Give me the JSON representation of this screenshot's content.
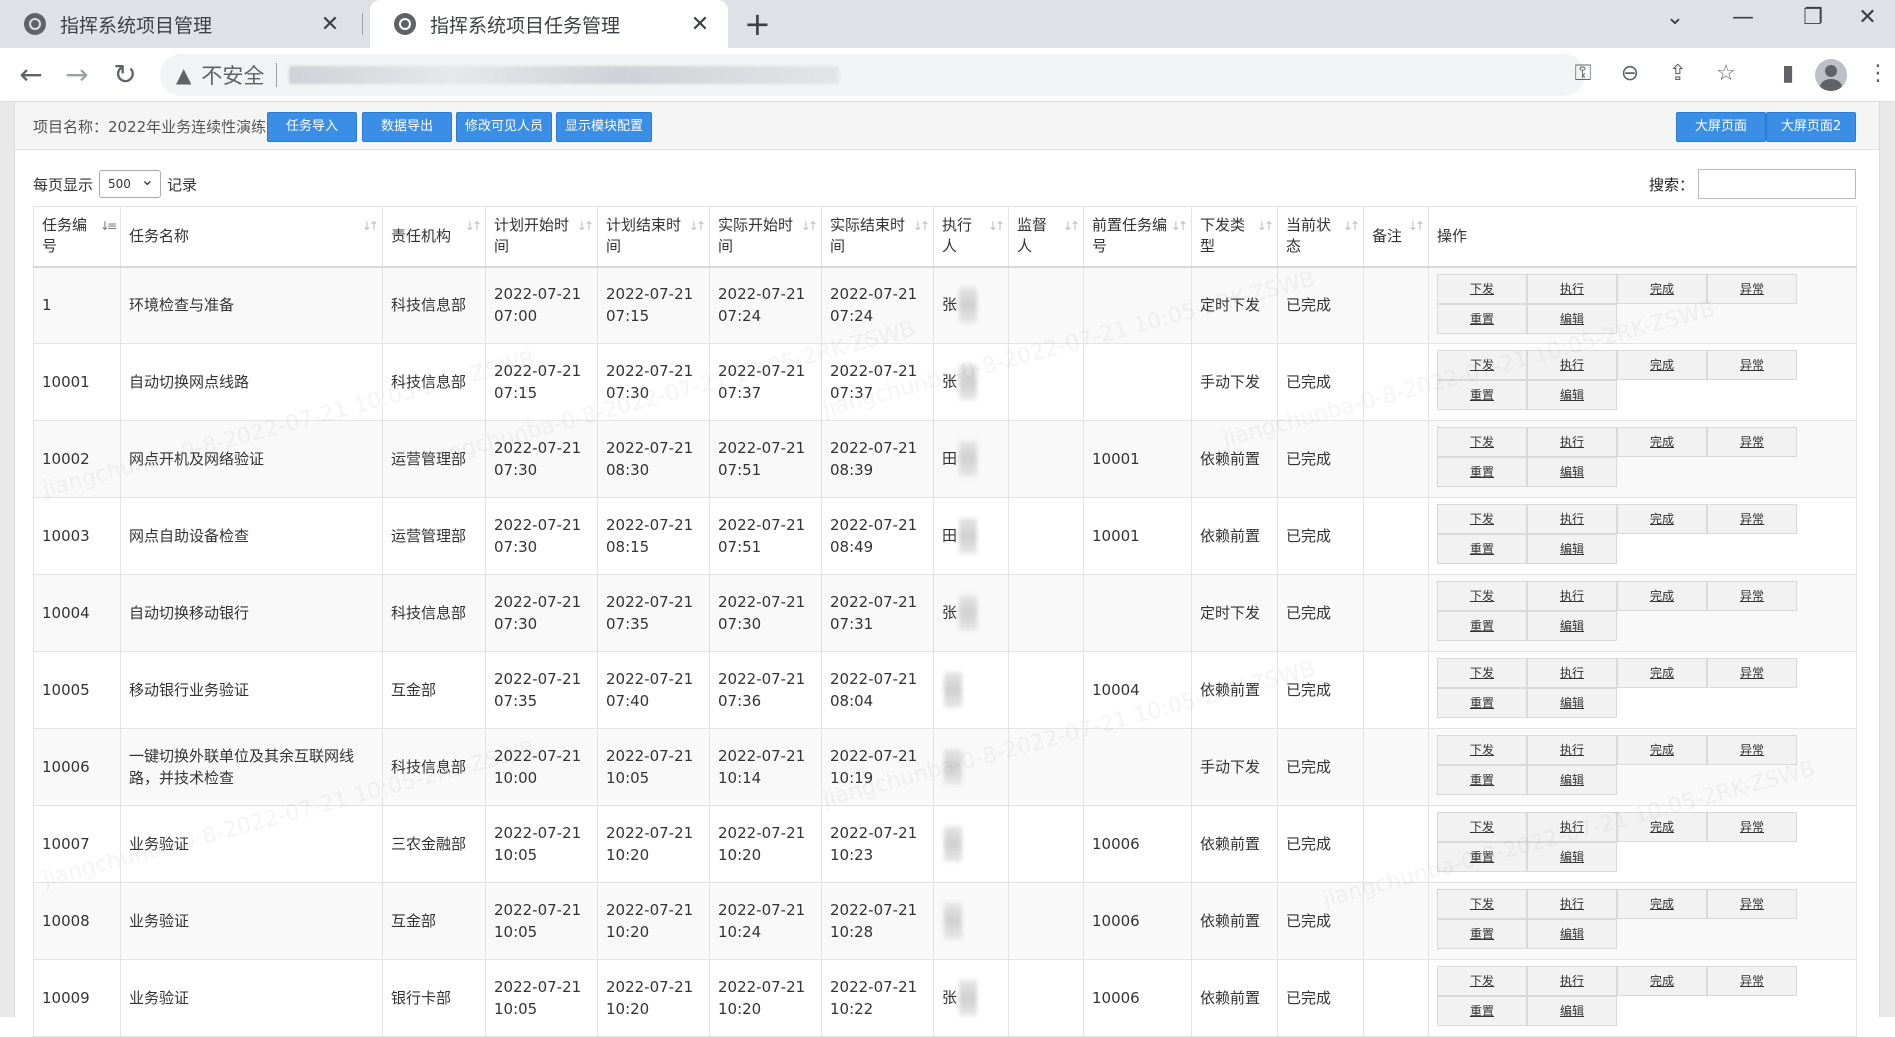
{
  "browser": {
    "tabs": [
      {
        "title": "指挥系统项目管理",
        "close": "✕"
      },
      {
        "title": "指挥系统项目任务管理",
        "close": "✕"
      }
    ],
    "new_tab": "+",
    "window": {
      "minimize": "—",
      "maximize": "❐",
      "dropdown": "⌄"
    },
    "insecure_label": "不安全",
    "icons": {
      "back": "←",
      "forward": "→",
      "reload": "↻",
      "warn": "▲",
      "key": "⚿",
      "zoom": "⊖",
      "share": "⇪",
      "star": "☆",
      "sidepanel": "▮",
      "menu": "⋮"
    }
  },
  "actionbar": {
    "project_label": "项目名称：2022年业务连续性演练",
    "buttons": [
      "任务导入",
      "数据导出",
      "修改可见人员",
      "显示模块配置"
    ],
    "right_buttons": [
      "大屏页面",
      "大屏页面2"
    ]
  },
  "table_controls": {
    "per_page_prefix": "每页显示",
    "per_page_value": "500",
    "per_page_suffix": "记录",
    "search_label": "搜索："
  },
  "table": {
    "headers": [
      "任务编号",
      "任务名称",
      "责任机构",
      "计划开始时间",
      "计划结束时间",
      "实际开始时间",
      "实际结束时间",
      "执行人",
      "监督人",
      "前置任务编号",
      "下发类型",
      "当前状态",
      "备注",
      "操作"
    ],
    "op_labels": [
      "下发",
      "执行",
      "完成",
      "异常",
      "重置",
      "编辑"
    ],
    "rows": [
      {
        "id": "1",
        "name": "环境检查与准备",
        "org": "科技信息部",
        "ps_d": "2022-07-21",
        "ps_t": "07:00",
        "pe_d": "2022-07-21",
        "pe_t": "07:15",
        "as_d": "2022-07-21",
        "as_t": "07:24",
        "ae_d": "2022-07-21",
        "ae_t": "07:24",
        "exec": "张",
        "sup": "",
        "pre": "",
        "type": "定时下发",
        "status": "已完成",
        "note": ""
      },
      {
        "id": "10001",
        "name": "自动切换网点线路",
        "org": "科技信息部",
        "ps_d": "2022-07-21",
        "ps_t": "07:15",
        "pe_d": "2022-07-21",
        "pe_t": "07:30",
        "as_d": "2022-07-21",
        "as_t": "07:37",
        "ae_d": "2022-07-21",
        "ae_t": "07:37",
        "exec": "张",
        "sup": "",
        "pre": "",
        "type": "手动下发",
        "status": "已完成",
        "note": ""
      },
      {
        "id": "10002",
        "name": "网点开机及网络验证",
        "org": "运营管理部",
        "ps_d": "2022-07-21",
        "ps_t": "07:30",
        "pe_d": "2022-07-21",
        "pe_t": "08:30",
        "as_d": "2022-07-21",
        "as_t": "07:51",
        "ae_d": "2022-07-21",
        "ae_t": "08:39",
        "exec": "田",
        "sup": "",
        "pre": "10001",
        "type": "依赖前置",
        "status": "已完成",
        "note": ""
      },
      {
        "id": "10003",
        "name": "网点自助设备检查",
        "org": "运营管理部",
        "ps_d": "2022-07-21",
        "ps_t": "07:30",
        "pe_d": "2022-07-21",
        "pe_t": "08:15",
        "as_d": "2022-07-21",
        "as_t": "07:51",
        "ae_d": "2022-07-21",
        "ae_t": "08:49",
        "exec": "田",
        "sup": "",
        "pre": "10001",
        "type": "依赖前置",
        "status": "已完成",
        "note": ""
      },
      {
        "id": "10004",
        "name": "自动切换移动银行",
        "org": "科技信息部",
        "ps_d": "2022-07-21",
        "ps_t": "07:30",
        "pe_d": "2022-07-21",
        "pe_t": "07:35",
        "as_d": "2022-07-21",
        "as_t": "07:30",
        "ae_d": "2022-07-21",
        "ae_t": "07:31",
        "exec": "张",
        "sup": "",
        "pre": "",
        "type": "定时下发",
        "status": "已完成",
        "note": ""
      },
      {
        "id": "10005",
        "name": "移动银行业务验证",
        "org": "互金部",
        "ps_d": "2022-07-21",
        "ps_t": "07:35",
        "pe_d": "2022-07-21",
        "pe_t": "07:40",
        "as_d": "2022-07-21",
        "as_t": "07:36",
        "ae_d": "2022-07-21",
        "ae_t": "08:04",
        "exec": "",
        "sup": "",
        "pre": "10004",
        "type": "依赖前置",
        "status": "已完成",
        "note": ""
      },
      {
        "id": "10006",
        "name": "一键切换外联单位及其余互联网线路，并技术检查",
        "org": "科技信息部",
        "ps_d": "2022-07-21",
        "ps_t": "10:00",
        "pe_d": "2022-07-21",
        "pe_t": "10:05",
        "as_d": "2022-07-21",
        "as_t": "10:14",
        "ae_d": "2022-07-21",
        "ae_t": "10:19",
        "exec": "",
        "sup": "",
        "pre": "",
        "type": "手动下发",
        "status": "已完成",
        "note": ""
      },
      {
        "id": "10007",
        "name": "业务验证",
        "org": "三农金融部",
        "ps_d": "2022-07-21",
        "ps_t": "10:05",
        "pe_d": "2022-07-21",
        "pe_t": "10:20",
        "as_d": "2022-07-21",
        "as_t": "10:20",
        "ae_d": "2022-07-21",
        "ae_t": "10:23",
        "exec": "",
        "sup": "",
        "pre": "10006",
        "type": "依赖前置",
        "status": "已完成",
        "note": ""
      },
      {
        "id": "10008",
        "name": "业务验证",
        "org": "互金部",
        "ps_d": "2022-07-21",
        "ps_t": "10:05",
        "pe_d": "2022-07-21",
        "pe_t": "10:20",
        "as_d": "2022-07-21",
        "as_t": "10:24",
        "ae_d": "2022-07-21",
        "ae_t": "10:28",
        "exec": "",
        "sup": "",
        "pre": "10006",
        "type": "依赖前置",
        "status": "已完成",
        "note": ""
      },
      {
        "id": "10009",
        "name": "业务验证",
        "org": "银行卡部",
        "ps_d": "2022-07-21",
        "ps_t": "10:05",
        "pe_d": "2022-07-21",
        "pe_t": "10:20",
        "as_d": "2022-07-21",
        "as_t": "10:20",
        "ae_d": "2022-07-21",
        "ae_t": "10:22",
        "exec": "张",
        "sup": "",
        "pre": "10006",
        "type": "依赖前置",
        "status": "已完成",
        "note": ""
      }
    ]
  }
}
